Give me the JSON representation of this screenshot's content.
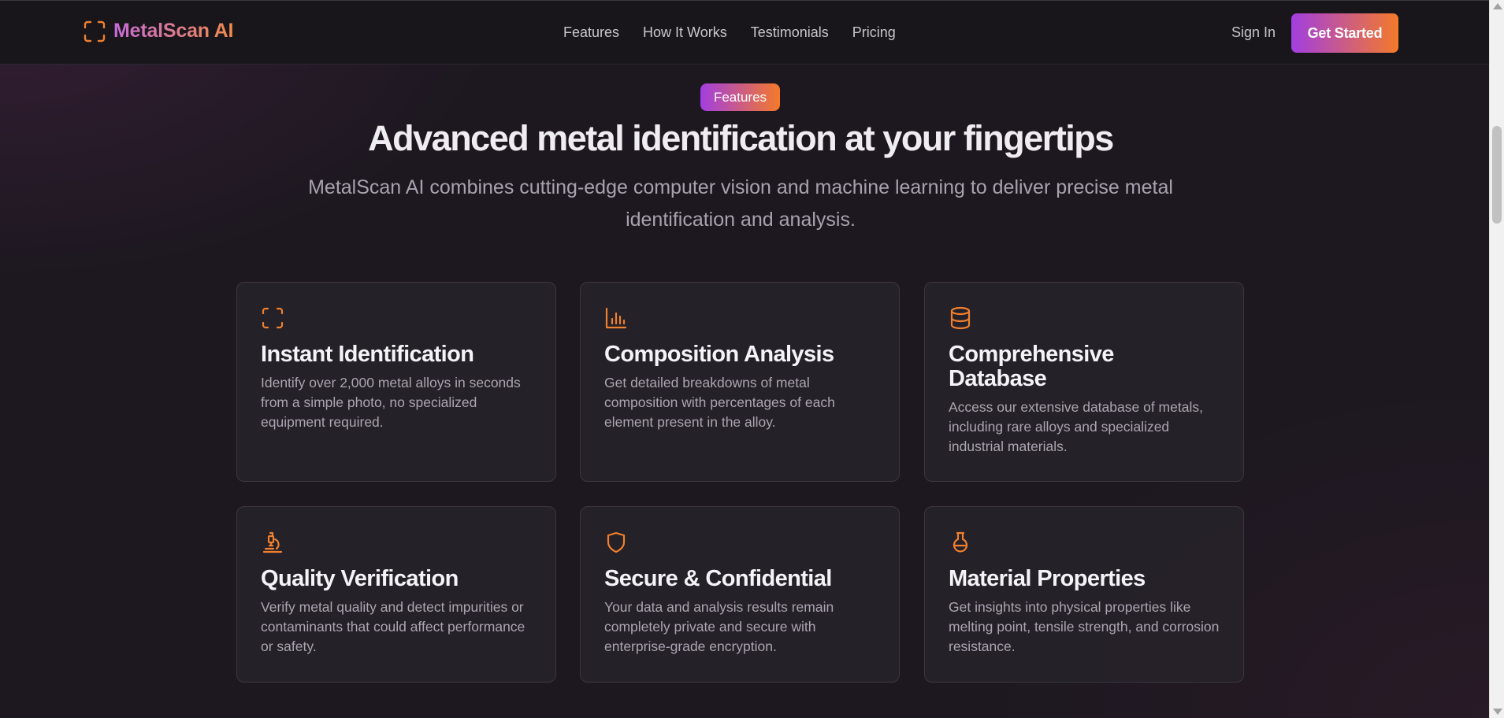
{
  "nav": {
    "brand": "MetalScan AI",
    "links": [
      "Features",
      "How It Works",
      "Testimonials",
      "Pricing"
    ],
    "signin": "Sign In",
    "cta": "Get Started"
  },
  "hero": {
    "badge": "Features",
    "headline": "Advanced metal identification at your fingertips",
    "subhead": "MetalScan AI combines cutting-edge computer vision and machine learning to deliver precise metal identification and analysis."
  },
  "features": [
    {
      "icon": "scan-icon",
      "title": "Instant Identification",
      "desc": "Identify over 2,000 metal alloys in seconds from a simple photo, no specialized equipment required."
    },
    {
      "icon": "bar-chart-icon",
      "title": "Composition Analysis",
      "desc": "Get detailed breakdowns of metal composition with percentages of each element present in the alloy."
    },
    {
      "icon": "database-icon",
      "title": "Comprehensive Database",
      "desc": "Access our extensive database of metals, including rare alloys and specialized industrial materials."
    },
    {
      "icon": "microscope-icon",
      "title": "Quality Verification",
      "desc": "Verify metal quality and detect impurities or contaminants that could affect performance or safety."
    },
    {
      "icon": "shield-icon",
      "title": "Secure & Confidential",
      "desc": "Your data and analysis results remain completely private and secure with enterprise-grade encryption."
    },
    {
      "icon": "flask-icon",
      "title": "Material Properties",
      "desc": "Get insights into physical properties like melting point, tensile strength, and corrosion resistance."
    }
  ],
  "colors": {
    "accent_purple": "#a23ee0",
    "accent_orange": "#f47a2a",
    "icon_orange": "#f0802e",
    "background": "#1d1820"
  }
}
